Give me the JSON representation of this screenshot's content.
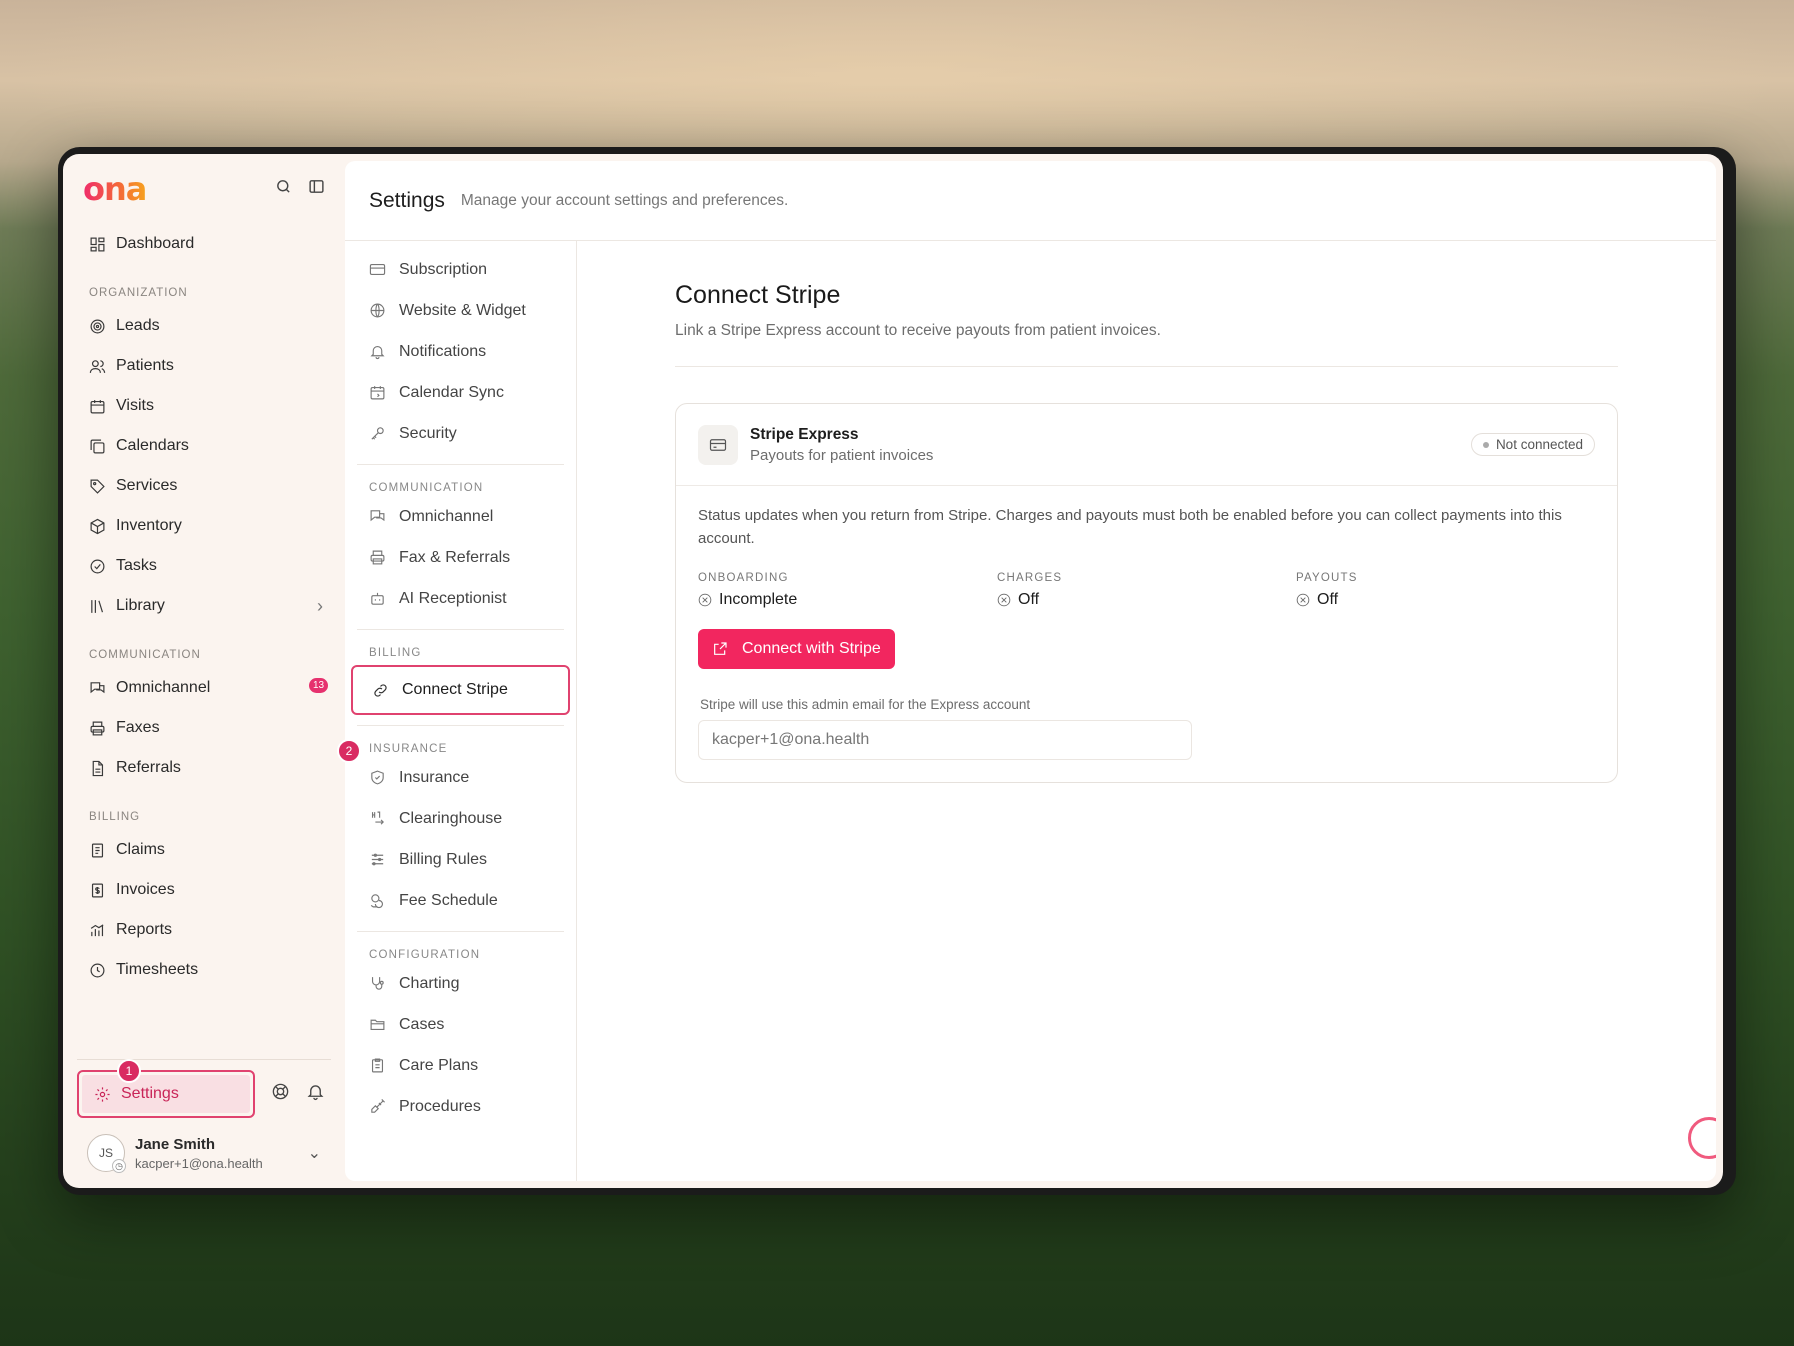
{
  "app": {
    "logo": "ona"
  },
  "sidebar": {
    "top_item": "Dashboard",
    "sections": [
      {
        "label": "ORGANIZATION",
        "items": [
          "Leads",
          "Patients",
          "Visits",
          "Calendars",
          "Services",
          "Inventory",
          "Tasks",
          "Library"
        ]
      },
      {
        "label": "COMMUNICATION",
        "items": [
          "Omnichannel",
          "Faxes",
          "Referrals"
        ]
      },
      {
        "label": "BILLING",
        "items": [
          "Claims",
          "Invoices",
          "Reports",
          "Timesheets"
        ]
      }
    ],
    "omnichannel_badge": "13",
    "settings_label": "Settings",
    "user": {
      "initials": "JS",
      "name": "Jane Smith",
      "email": "kacper+1@ona.health"
    }
  },
  "steps": {
    "one": "1",
    "two": "2"
  },
  "header": {
    "title": "Settings",
    "subtitle": "Manage your account settings and preferences."
  },
  "subnav": {
    "general": [
      "Subscription",
      "Website & Widget",
      "Notifications",
      "Calendar Sync",
      "Security"
    ],
    "communication": {
      "label": "COMMUNICATION",
      "items": [
        "Omnichannel",
        "Fax & Referrals",
        "AI Receptionist"
      ]
    },
    "billing": {
      "label": "BILLING",
      "active": "Connect Stripe"
    },
    "insurance": {
      "label": "INSURANCE",
      "items": [
        "Insurance",
        "Clearinghouse",
        "Billing Rules",
        "Fee Schedule"
      ]
    },
    "configuration": {
      "label": "CONFIGURATION",
      "items": [
        "Charting",
        "Cases",
        "Care Plans",
        "Procedures"
      ]
    }
  },
  "panel": {
    "title": "Connect Stripe",
    "subtitle": "Link a Stripe Express account to receive payouts from patient invoices.",
    "card": {
      "title": "Stripe Express",
      "desc": "Payouts for patient invoices",
      "status": "Not connected",
      "note": "Status updates when you return from Stripe. Charges and payouts must both be enabled before you can collect payments into this account.",
      "metrics": [
        {
          "label": "ONBOARDING",
          "value": "Incomplete"
        },
        {
          "label": "CHARGES",
          "value": "Off"
        },
        {
          "label": "PAYOUTS",
          "value": "Off"
        }
      ],
      "button": "Connect with Stripe",
      "email_label": "Stripe will use this admin email for the Express account",
      "email_value": "kacper+1@ona.health"
    }
  },
  "colors": {
    "accent": "#f2265f",
    "highlight": "#e0426f",
    "sidebar_bg": "#fbf4ef"
  }
}
